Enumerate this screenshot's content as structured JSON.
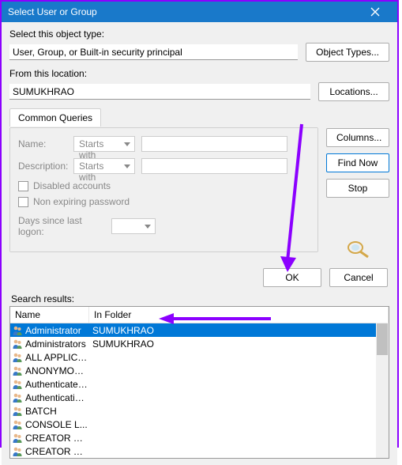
{
  "title": "Select User or Group",
  "object_type_label": "Select this object type:",
  "object_type_value": "User, Group, or Built-in security principal",
  "object_types_btn": "Object Types...",
  "location_label": "From this location:",
  "location_value": "SUMUKHRAO",
  "locations_btn": "Locations...",
  "common_queries_tab": "Common Queries",
  "name_label": "Name:",
  "desc_label": "Description:",
  "starts_with": "Starts with",
  "disabled_accounts": "Disabled accounts",
  "non_expiring": "Non expiring password",
  "days_label": "Days since last logon:",
  "columns_btn": "Columns...",
  "findnow_btn": "Find Now",
  "stop_btn": "Stop",
  "ok_btn": "OK",
  "cancel_btn": "Cancel",
  "results_label": "Search results:",
  "col_name": "Name",
  "col_folder": "In Folder",
  "rows": [
    {
      "name": "Administrator",
      "folder": "SUMUKHRAO",
      "selected": true
    },
    {
      "name": "Administrators",
      "folder": "SUMUKHRAO",
      "selected": false
    },
    {
      "name": "ALL APPLICA...",
      "folder": "",
      "selected": false
    },
    {
      "name": "ANONYMOU...",
      "folder": "",
      "selected": false
    },
    {
      "name": "Authenticated...",
      "folder": "",
      "selected": false
    },
    {
      "name": "Authenticatio...",
      "folder": "",
      "selected": false
    },
    {
      "name": "BATCH",
      "folder": "",
      "selected": false
    },
    {
      "name": "CONSOLE L...",
      "folder": "",
      "selected": false
    },
    {
      "name": "CREATOR G...",
      "folder": "",
      "selected": false
    },
    {
      "name": "CREATOR O...",
      "folder": "",
      "selected": false
    }
  ]
}
